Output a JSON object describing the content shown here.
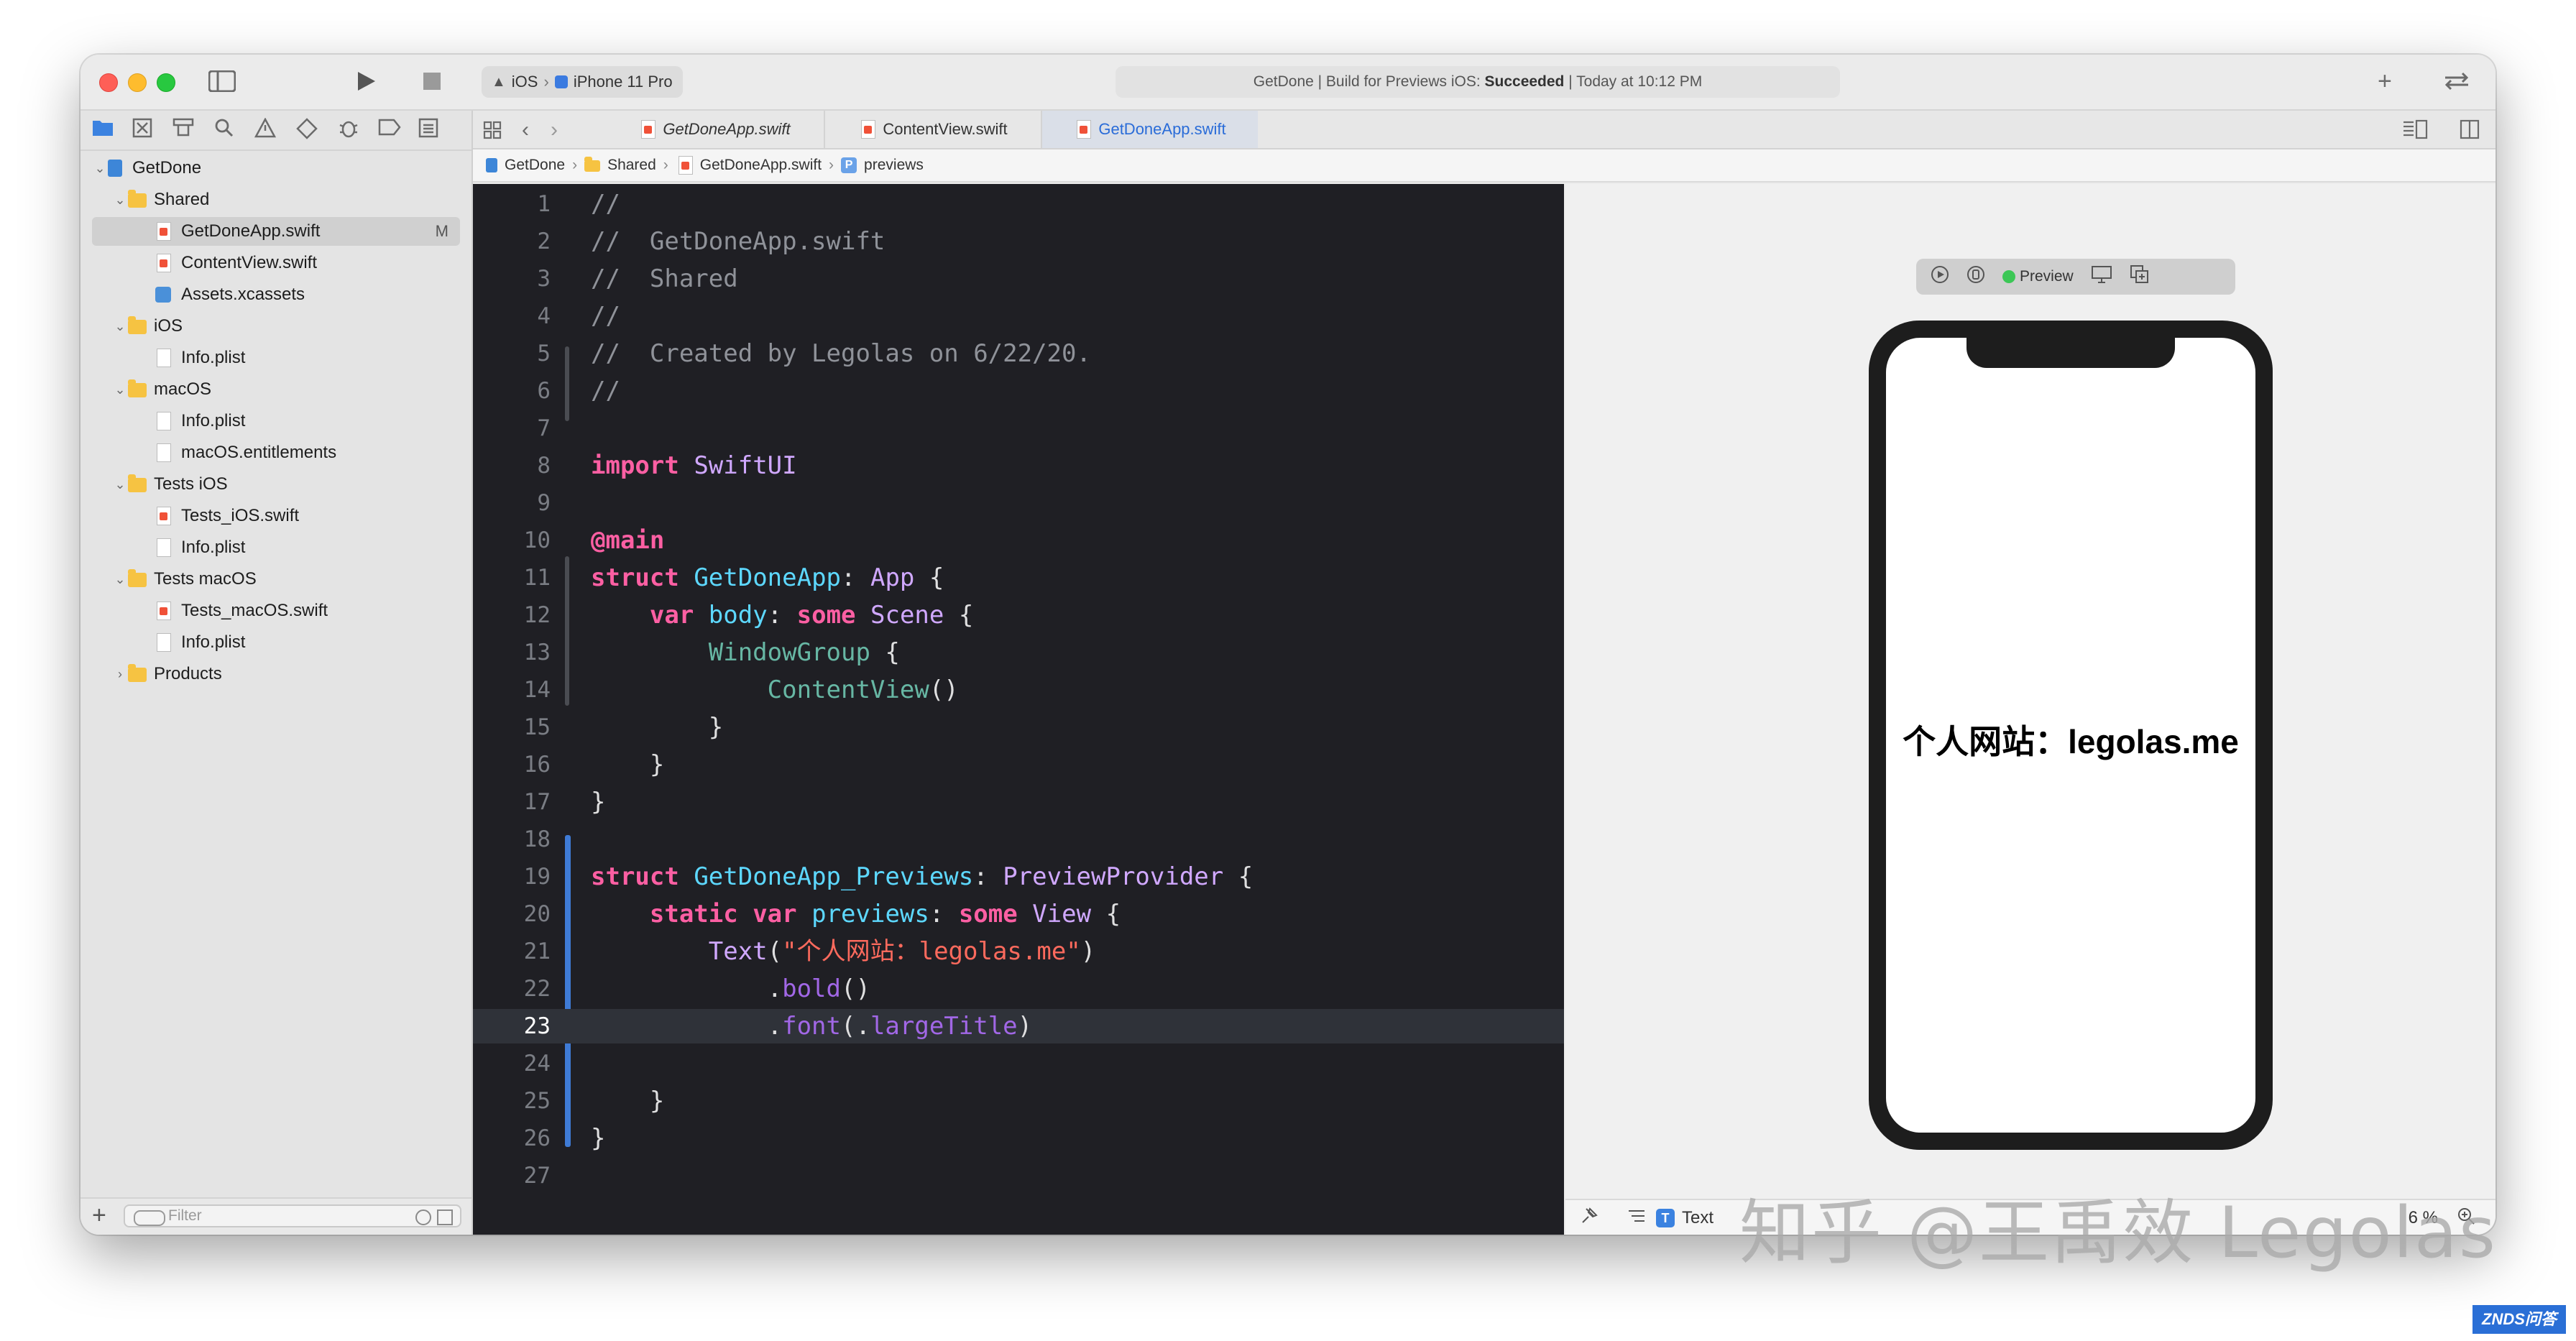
{
  "toolbar": {
    "scheme_platform": "iOS",
    "scheme_device": "iPhone 11 Pro",
    "activity_prefix": "GetDone | Build for Previews iOS: ",
    "activity_status": "Succeeded",
    "activity_suffix": " | Today at 10:12 PM",
    "add_label": "+"
  },
  "navigator": {
    "items": [
      {
        "label": "GetDone",
        "indent": 0,
        "kind": "project",
        "chevron": "⌄"
      },
      {
        "label": "Shared",
        "indent": 1,
        "kind": "folder",
        "chevron": "⌄"
      },
      {
        "label": "GetDoneApp.swift",
        "indent": 2,
        "kind": "swift",
        "chevron": "",
        "badge": "M",
        "selected": true
      },
      {
        "label": "ContentView.swift",
        "indent": 2,
        "kind": "swift",
        "chevron": ""
      },
      {
        "label": "Assets.xcassets",
        "indent": 2,
        "kind": "assets",
        "chevron": ""
      },
      {
        "label": "iOS",
        "indent": 1,
        "kind": "folder",
        "chevron": "⌄"
      },
      {
        "label": "Info.plist",
        "indent": 2,
        "kind": "file",
        "chevron": ""
      },
      {
        "label": "macOS",
        "indent": 1,
        "kind": "folder",
        "chevron": "⌄"
      },
      {
        "label": "Info.plist",
        "indent": 2,
        "kind": "file",
        "chevron": ""
      },
      {
        "label": "macOS.entitlements",
        "indent": 2,
        "kind": "file",
        "chevron": ""
      },
      {
        "label": "Tests iOS",
        "indent": 1,
        "kind": "folder",
        "chevron": "⌄"
      },
      {
        "label": "Tests_iOS.swift",
        "indent": 2,
        "kind": "swift",
        "chevron": ""
      },
      {
        "label": "Info.plist",
        "indent": 2,
        "kind": "file",
        "chevron": ""
      },
      {
        "label": "Tests macOS",
        "indent": 1,
        "kind": "folder",
        "chevron": "⌄"
      },
      {
        "label": "Tests_macOS.swift",
        "indent": 2,
        "kind": "swift",
        "chevron": ""
      },
      {
        "label": "Info.plist",
        "indent": 2,
        "kind": "file",
        "chevron": ""
      },
      {
        "label": "Products",
        "indent": 1,
        "kind": "folder",
        "chevron": "›"
      }
    ],
    "filter_placeholder": "Filter",
    "add_label": "+"
  },
  "tabs": [
    {
      "label": "GetDoneApp.swift",
      "italic": true
    },
    {
      "label": "ContentView.swift",
      "italic": false
    },
    {
      "label": "GetDoneApp.swift",
      "italic": false,
      "active": true
    }
  ],
  "breadcrumb": [
    "GetDone",
    "Shared",
    "GetDoneApp.swift",
    "previews"
  ],
  "editor": {
    "current_line": 23,
    "lines": [
      "//",
      "//  GetDoneApp.swift",
      "//  Shared",
      "//",
      "//  Created by Legolas on 6/22/20.",
      "//",
      "",
      "import SwiftUI",
      "",
      "@main",
      "struct GetDoneApp: App {",
      "    var body: some Scene {",
      "        WindowGroup {",
      "            ContentView()",
      "        }",
      "    }",
      "}",
      "",
      "struct GetDoneApp_Previews: PreviewProvider {",
      "    static var previews: some View {",
      "        Text(\"个人网站：legolas.me\")",
      "            .bold()",
      "            .font(.largeTitle)",
      "",
      "    }",
      "}",
      ""
    ]
  },
  "preview": {
    "badge_label": "Preview",
    "preview_text": "个人网站：legolas.me",
    "bottom_selection": "Text",
    "zoom": "6 %"
  },
  "watermark": {
    "text": "知乎 @王禹效 Legolas",
    "site_logo": "ZNDS问答"
  }
}
